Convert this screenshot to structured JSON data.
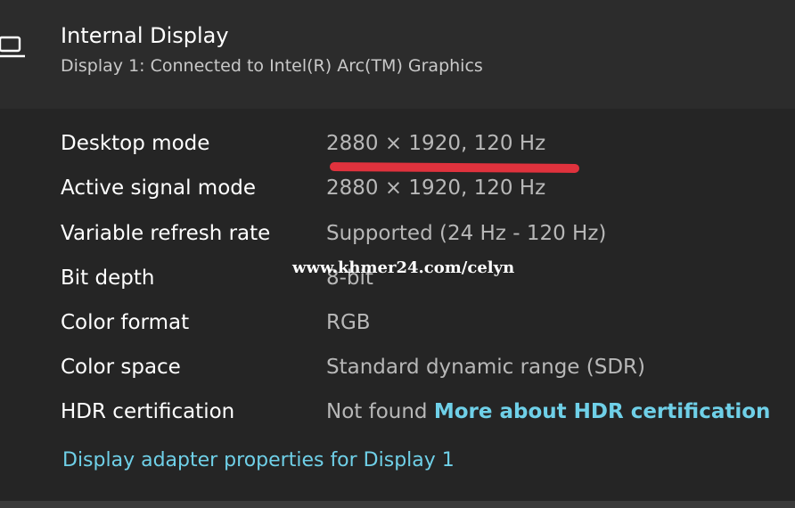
{
  "header": {
    "icon": "laptop-icon",
    "title": "Internal Display",
    "subtitle": "Display 1: Connected to Intel(R) Arc(TM) Graphics"
  },
  "details": [
    {
      "label": "Desktop mode",
      "value": "2880 × 1920, 120 Hz"
    },
    {
      "label": "Active signal mode",
      "value": "2880 × 1920, 120 Hz"
    },
    {
      "label": "Variable refresh rate",
      "value": "Supported (24 Hz - 120 Hz)"
    },
    {
      "label": "Bit depth",
      "value": "8-bit"
    },
    {
      "label": "Color format",
      "value": "RGB"
    },
    {
      "label": "Color space",
      "value": "Standard dynamic range (SDR)"
    },
    {
      "label": "HDR certification",
      "value": "Not found",
      "link": "More about HDR certification"
    }
  ],
  "adapter_link": "Display adapter properties for Display 1",
  "watermark": "www.khmer24.com/celyn",
  "colors": {
    "link": "#6fd0e8",
    "annotation": "#e0323d",
    "header_bg": "#2c2c2c",
    "panel_bg": "#252525"
  }
}
